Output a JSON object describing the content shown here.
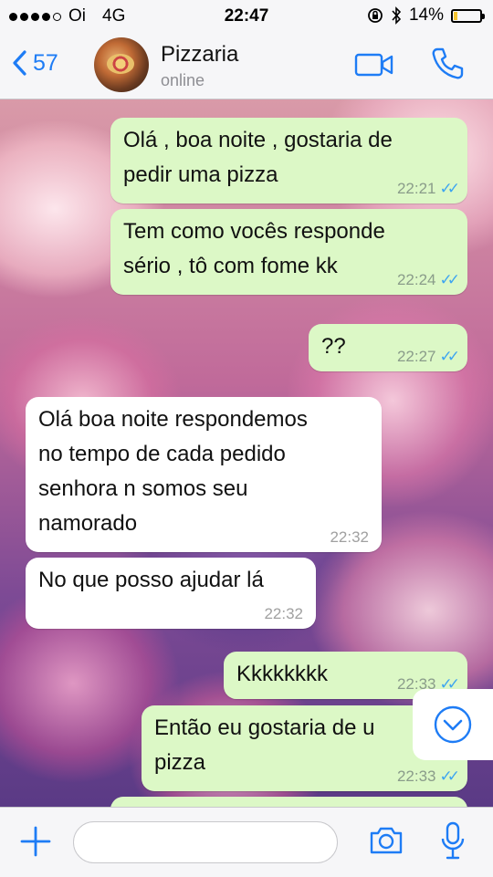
{
  "status_bar": {
    "carrier": "Oi",
    "network": "4G",
    "time": "22:47",
    "battery": "14%",
    "battery_level": 0.14
  },
  "header": {
    "back_count": "57",
    "contact_name": "Pizzaria",
    "contact_status": "online"
  },
  "messages": [
    {
      "direction": "out",
      "text": "Olá , boa noite , gostaria de\npedir uma pizza",
      "time": "22:21",
      "read": true
    },
    {
      "direction": "out",
      "text": "Tem como vocês responde\nsério , tô com fome kk",
      "time": "22:24",
      "read": true
    },
    {
      "direction": "out",
      "text": "??",
      "time": "22:27",
      "read": true
    },
    {
      "direction": "in",
      "text": "Olá boa noite respondemos\nno tempo de cada pedido\nsenhora n somos seu\nnamorado",
      "time": "22:32"
    },
    {
      "direction": "in",
      "text": "No que posso ajudar lá",
      "time": "22:32"
    },
    {
      "direction": "out",
      "text": "Kkkkkkkk",
      "time": "22:33",
      "read": true
    },
    {
      "direction": "out",
      "text": "Então eu gostaria de u\npizza",
      "time": "22:33",
      "read": true
    }
  ],
  "input": {
    "placeholder": ""
  },
  "colors": {
    "accent": "#1e7cf5",
    "outgoing_bubble": "#dcf8c6",
    "incoming_bubble": "#ffffff",
    "read_ticks": "#3ea5f0"
  },
  "icons": [
    "back-chevron-icon",
    "video-call-icon",
    "phone-icon",
    "plus-icon",
    "camera-icon",
    "microphone-icon",
    "scroll-down-icon"
  ]
}
